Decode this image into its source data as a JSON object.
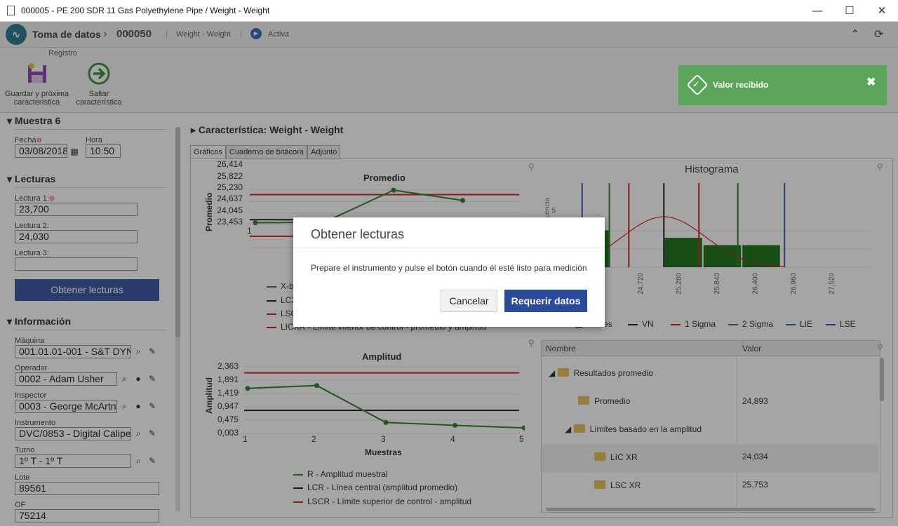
{
  "window": {
    "title": "000005 - PE 200 SDR 11 Gas Polyethylene Pipe / Weight - Weight",
    "minimize": "—",
    "maximize": "☐",
    "close": "✕"
  },
  "header": {
    "app": "Toma de datos",
    "record": "000050",
    "context": "Weight - Weight",
    "status": "Activa",
    "collapse_icon": "⌃",
    "refresh_icon": "⟳"
  },
  "ribbon": {
    "group": "Registro",
    "save_next_l1": "Guardar y próxima",
    "save_next_l2": "característica",
    "skip_l1": "Saltar",
    "skip_l2": "característica"
  },
  "sample": {
    "title": "Muestra 6",
    "date_label": "Fecha",
    "date": "03/08/2018",
    "time_label": "Hora",
    "time": "10:50"
  },
  "readings": {
    "title": "Lecturas",
    "items": [
      {
        "label": "Lectura 1:",
        "value": "23,700"
      },
      {
        "label": "Lectura 2:",
        "value": "24,030"
      },
      {
        "label": "Lectura 3:",
        "value": ""
      }
    ],
    "button": "Obtener lecturas"
  },
  "info": {
    "title": "Información",
    "machine_label": "Máquina",
    "machine": "001.01.01-001 - S&T DYNA",
    "operator_label": "Operador",
    "operator": "0002 - Adam Usher",
    "inspector_label": "Inspector",
    "inspector": "0003 - George McArtney",
    "instrument_label": "Instrumento",
    "instrument": "DVC/0853 - Digital Caliper (",
    "shift_label": "Turno",
    "shift": "1º T - 1º T",
    "lot_label": "Lote",
    "lot": "89561",
    "of_label": "OF",
    "of": "75214"
  },
  "characteristic": {
    "title": "Característica: Weight - Weight"
  },
  "tabs": [
    {
      "label": "Gráficos"
    },
    {
      "label": "Cuaderno de bitácora"
    },
    {
      "label": "Adjunto"
    }
  ],
  "avg_chart": {
    "title": "Promedio",
    "ylabel": "Promedio",
    "yticks": [
      "26,414",
      "25,822",
      "25,230",
      "24,637",
      "24,045",
      "23,453"
    ],
    "xticks": [
      "1"
    ],
    "legend": [
      "X-b",
      "LCX",
      "LSC",
      "LICXR - Límite inferior de control - promedio y amplitud"
    ]
  },
  "range_chart": {
    "title": "Amplitud",
    "ylabel": "Amplitud",
    "xlabel": "Muestras",
    "yticks": [
      "2,363",
      "1,891",
      "1,419",
      "0,947",
      "0,475",
      "0,003"
    ],
    "xticks": [
      "1",
      "2",
      "3",
      "4",
      "5"
    ],
    "legend": [
      "R - Amplitud muestral",
      "LCR - Línea central (amplitud promedio)",
      "LSCR - Límite superior de control - amplitud"
    ]
  },
  "histogram": {
    "title": "Histograma",
    "ylabel": "Frecuencia",
    "ytick": "5",
    "xticks": [
      "23,600",
      "24,160",
      "24,720",
      "25,280",
      "25,840",
      "26,400",
      "26,960",
      "27,520"
    ],
    "legend": [
      "Clases",
      "VN",
      "1 Sigma",
      "2 Sigma",
      "LIE",
      "LSE"
    ]
  },
  "chart_data": [
    {
      "type": "line",
      "title": "Promedio",
      "ylabel": "Promedio",
      "x": [
        1,
        2,
        3,
        4,
        5
      ],
      "series": [
        {
          "name": "X-b",
          "values": [
            24.73,
            24.76,
            26.41,
            25.88,
            null
          ]
        }
      ],
      "reference_lines": {
        "LSC": 26.18,
        "LC": 24.89,
        "LIC": 24.034
      },
      "ylim": [
        23.453,
        26.414
      ]
    },
    {
      "type": "line",
      "title": "Amplitud",
      "xlabel": "Muestras",
      "ylabel": "Amplitud",
      "x": [
        1,
        2,
        3,
        4,
        5
      ],
      "series": [
        {
          "name": "R - Amplitud muestral",
          "values": [
            1.6,
            1.7,
            0.39,
            0.29,
            0.2
          ]
        }
      ],
      "reference_lines": {
        "LSCR": 2.15,
        "LCR": 0.82
      },
      "ylim": [
        0.003,
        2.363
      ]
    },
    {
      "type": "bar",
      "title": "Histograma",
      "bins": [
        {
          "from": 23.7,
          "to": 24.2,
          "count": 5
        },
        {
          "from": 24.9,
          "to": 25.4,
          "count": 4
        },
        {
          "from": 25.4,
          "to": 25.9,
          "count": 3
        },
        {
          "from": 25.9,
          "to": 26.4,
          "count": 3
        }
      ],
      "xlim": [
        23.6,
        27.52
      ]
    }
  ],
  "results": {
    "col_name": "Nombre",
    "col_value": "Valor",
    "rows": [
      {
        "name": "Resultados promedio",
        "value": ""
      },
      {
        "name": "Promedio",
        "value": "24,893"
      },
      {
        "name": "Límites basado en la amplitud",
        "value": ""
      },
      {
        "name": "LIC XR",
        "value": "24,034"
      },
      {
        "name": "LSC XR",
        "value": "25,753"
      }
    ]
  },
  "dialog": {
    "title": "Obtener lecturas",
    "message": "Prepare el instrumento y pulse el botón cuando él esté listo para medición",
    "cancel": "Cancelar",
    "ok": "Requerir datos"
  },
  "toast": {
    "message": "Valor recibido",
    "close_icon": "✖",
    "check_icon": "✓"
  },
  "colors": {
    "accent": "#2b4a9b",
    "toast": "#5ba55b",
    "series": "#1a7a1a",
    "limit_red": "#cc1111"
  }
}
